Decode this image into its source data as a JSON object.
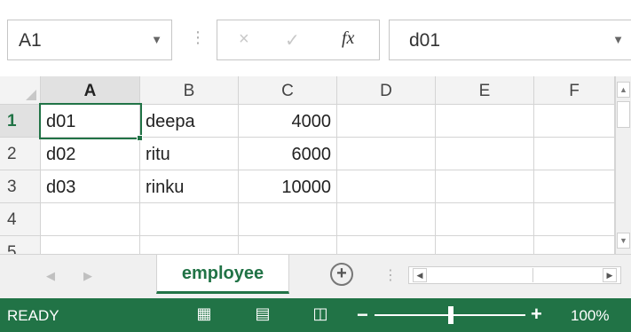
{
  "formula_bar": {
    "name_box": "A1",
    "cancel_icon": "×",
    "enter_icon": "✓",
    "fx_label": "fx",
    "value": "d01"
  },
  "grid": {
    "columns": [
      "A",
      "B",
      "C",
      "D",
      "E",
      "F"
    ],
    "rows": [
      "1",
      "2",
      "3",
      "4",
      "5"
    ],
    "cells": [
      [
        "d01",
        "deepa",
        "4000",
        "",
        "",
        ""
      ],
      [
        "d02",
        "ritu",
        "6000",
        "",
        "",
        ""
      ],
      [
        "d03",
        "rinku",
        "10000",
        "",
        "",
        ""
      ],
      [
        "",
        "",
        "",
        "",
        "",
        ""
      ],
      [
        "",
        "",
        "",
        "",
        "",
        ""
      ]
    ],
    "selected_cell": "A1"
  },
  "sheet_tabs": {
    "active": "employee",
    "add_icon": "+"
  },
  "status_bar": {
    "status": "READY",
    "zoom": "100%",
    "zoom_level": 1.0
  },
  "colors": {
    "accent": "#217346"
  }
}
